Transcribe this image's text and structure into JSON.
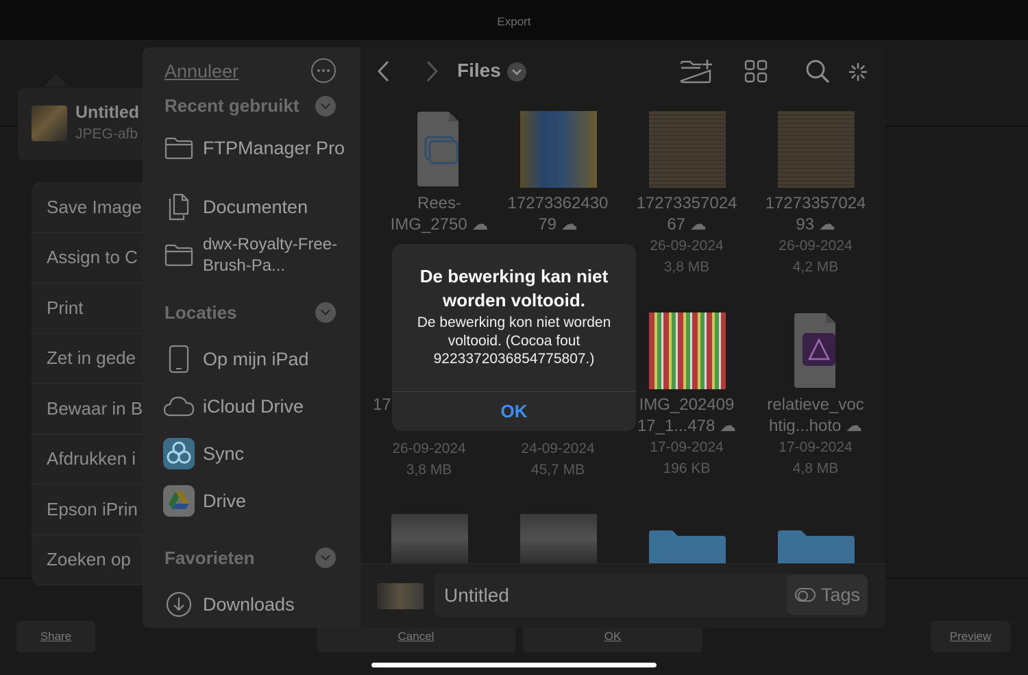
{
  "window": {
    "title": "Export"
  },
  "share_sheet": {
    "item_name": "Untitled",
    "item_type": "JPEG-afb",
    "actions": [
      "Save Image",
      "Assign to C",
      "Print",
      "Zet in gede",
      "Bewaar in B",
      "Afdrukken i",
      "Epson iPrin",
      "Zoeken op"
    ]
  },
  "bottom_buttons": {
    "share": "Share",
    "cancel": "Cancel",
    "ok": "OK",
    "preview": "Preview"
  },
  "sidebar": {
    "cancel": "Annuleer",
    "recent_header": "Recent gebruikt",
    "recent": [
      {
        "label": "FTPManager Pro",
        "icon": "folder-icon"
      },
      {
        "label": "Documenten",
        "icon": "documents-icon"
      },
      {
        "label": "dwx-Royalty-Free-Brush-Pa...",
        "icon": "folder-icon"
      }
    ],
    "locations_header": "Locaties",
    "locations": [
      {
        "label": "Op mijn iPad",
        "icon": "ipad-icon"
      },
      {
        "label": "iCloud Drive",
        "icon": "cloud-icon"
      },
      {
        "label": "Sync",
        "icon": "sync-app-icon"
      },
      {
        "label": "Drive",
        "icon": "google-drive-icon"
      }
    ],
    "favorites_header": "Favorieten",
    "favorites": [
      {
        "label": "Downloads",
        "icon": "download-icon"
      }
    ]
  },
  "browser": {
    "title": "Files",
    "files": [
      {
        "name1": "Rees-",
        "name2": "IMG_2750",
        "date": "",
        "size": ""
      },
      {
        "name1": "17273362430",
        "name2": "79",
        "date": "",
        "size": ""
      },
      {
        "name1": "17273357024",
        "name2": "67",
        "date": "26-09-2024",
        "size": "3,8 MB"
      },
      {
        "name1": "17273357024",
        "name2": "93",
        "date": "26-09-2024",
        "size": "4,2 MB"
      },
      {
        "name1": "17",
        "name2": "",
        "date": "26-09-2024",
        "size": "3,8 MB"
      },
      {
        "name1": "",
        "name2": "",
        "date": "24-09-2024",
        "size": "45,7 MB"
      },
      {
        "name1": "IMG_202409",
        "name2": "17_1...478",
        "date": "17-09-2024",
        "size": "196 KB"
      },
      {
        "name1": "relatieve_voc",
        "name2": "htig...hoto",
        "date": "17-09-2024",
        "size": "4,8 MB"
      }
    ],
    "filename_value": "Untitled",
    "tags_label": "Tags"
  },
  "alert": {
    "title": "De bewerking kan niet worden voltooid.",
    "message": "De bewerking kon niet worden voltooid. (Cocoa fout 9223372036854775807.)",
    "button": "OK",
    "accent": "#3b8ff0"
  }
}
